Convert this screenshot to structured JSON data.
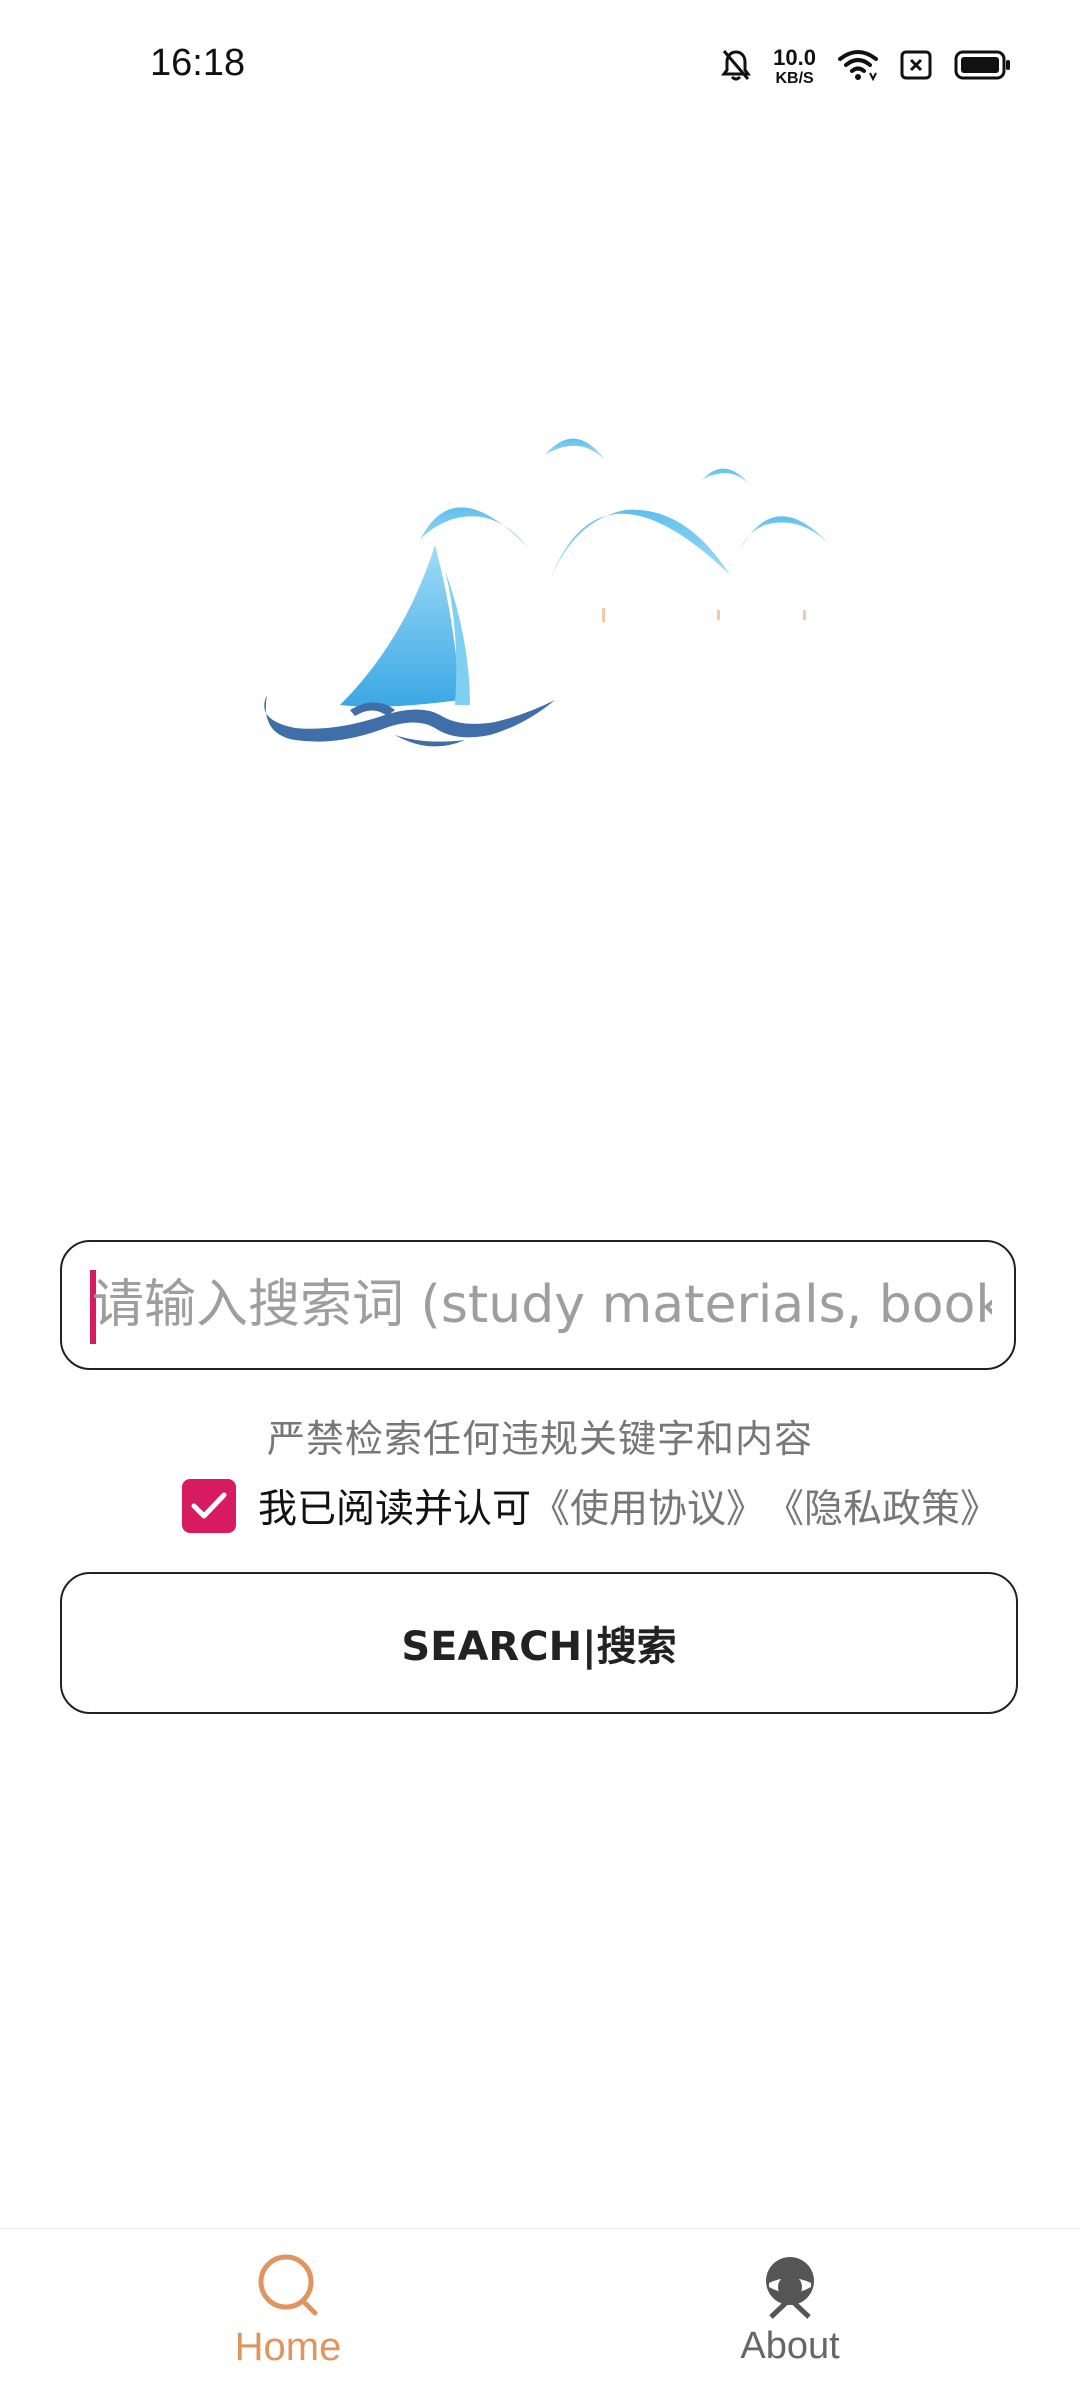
{
  "status_bar": {
    "time": "16:18",
    "net_speed_value": "10.0",
    "net_speed_unit": "KB/S",
    "icons": [
      "bell-muted-icon",
      "wifi-icon",
      "sim-off-icon",
      "battery-icon"
    ]
  },
  "search": {
    "placeholder": "请输入搜索词 (study materials, books, ...",
    "value": ""
  },
  "warning": "严禁检索任何违规关键字和内容",
  "agreement": {
    "checked": true,
    "text": "我已阅读并认可",
    "terms_link": "《使用协议》",
    "privacy_link": "《隐私政策》"
  },
  "search_button_label": "SEARCH|搜索",
  "bottom_nav": {
    "items": [
      {
        "label": "Home",
        "icon": "search-icon",
        "active": true
      },
      {
        "label": "About",
        "icon": "avatar-icon",
        "active": false
      }
    ]
  },
  "colors": {
    "accent": "#d81b60",
    "nav_active": "#e0955f",
    "logo_light_blue": "#6cc6f0",
    "logo_dark_blue": "#3f6ea8"
  }
}
